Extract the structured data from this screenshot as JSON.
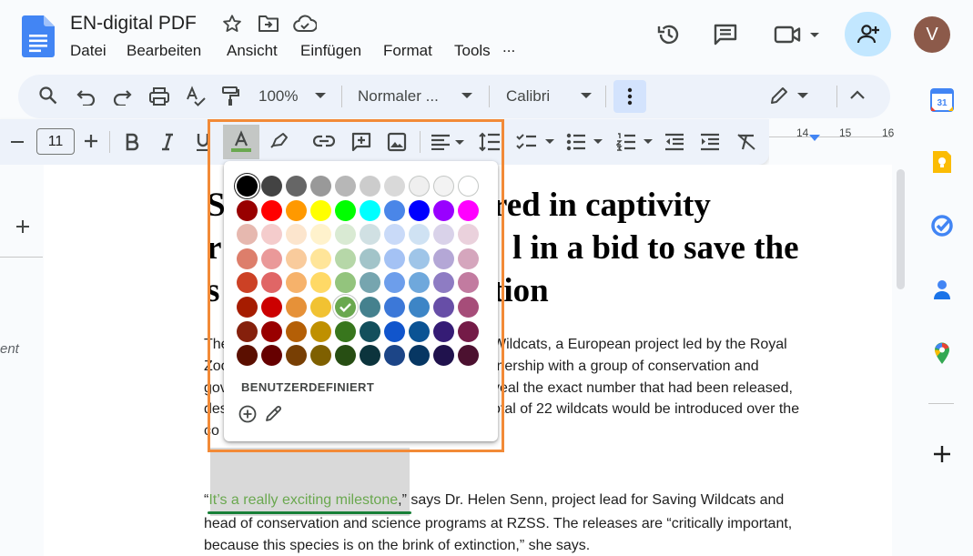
{
  "app": {
    "title": "EN-digital PDF",
    "menu": [
      "Datei",
      "Bearbeiten",
      "Ansicht",
      "Einfügen",
      "Format",
      "Tools",
      "..."
    ],
    "avatar_letter": "V"
  },
  "toolbar": {
    "zoom": "100%",
    "style": "Normaler ...",
    "font": "Calibri"
  },
  "format_bar": {
    "font_size": "11",
    "ruler_ticks": [
      "14",
      "15",
      "16"
    ]
  },
  "palette": {
    "custom_label": "BENUTZERDEFINIERT",
    "selected_color": "#6aa84f",
    "rows": [
      [
        "#000000",
        "#434343",
        "#666666",
        "#999999",
        "#b7b7b7",
        "#cccccc",
        "#d9d9d9",
        "#efefef",
        "#f3f3f3",
        "#ffffff"
      ],
      [
        "#980000",
        "#ff0000",
        "#ff9900",
        "#ffff00",
        "#00ff00",
        "#00ffff",
        "#4a86e8",
        "#0000ff",
        "#9900ff",
        "#ff00ff"
      ],
      [
        "#e6b8af",
        "#f4cccc",
        "#fce5cd",
        "#fff2cc",
        "#d9ead3",
        "#d0e0e3",
        "#c9daf8",
        "#cfe2f3",
        "#d9d2e9",
        "#ead1dc"
      ],
      [
        "#dd7e6b",
        "#ea9999",
        "#f9cb9c",
        "#ffe599",
        "#b6d7a8",
        "#a2c4c9",
        "#a4c2f4",
        "#9fc5e8",
        "#b4a7d6",
        "#d5a6bd"
      ],
      [
        "#cc4125",
        "#e06666",
        "#f6b26b",
        "#ffd966",
        "#93c47d",
        "#76a5af",
        "#6d9eeb",
        "#6fa8dc",
        "#8e7cc3",
        "#c27ba0"
      ],
      [
        "#a61c00",
        "#cc0000",
        "#e69138",
        "#f1c232",
        "#6aa84f",
        "#45818e",
        "#3c78d8",
        "#3d85c6",
        "#674ea7",
        "#a64d79"
      ],
      [
        "#85200c",
        "#990000",
        "#b45f06",
        "#bf9000",
        "#38761d",
        "#134f5c",
        "#1155cc",
        "#0b5394",
        "#351c75",
        "#741b47"
      ],
      [
        "#5b0f00",
        "#660000",
        "#783f04",
        "#7f6000",
        "#274e13",
        "#0c343d",
        "#1c4587",
        "#073763",
        "#20124d",
        "#4c1130"
      ]
    ]
  },
  "document": {
    "heading_lines": [
      {
        "left": "S",
        "right": "red in captivity"
      },
      {
        "left": "r",
        "right": "l in a bid to save the"
      },
      {
        "left": "s",
        "right": "tion"
      }
    ],
    "para1": [
      {
        "left": "The",
        "right": "Wildcats, a European project led by the Royal"
      },
      {
        "left": "Zoo",
        "right": "tnership with a group of conservation and"
      },
      {
        "left": "gov",
        "right": "veal the exact number that had been released,"
      },
      {
        "left": "des",
        "right": "otal of 22 wildcats would be introduced over the"
      },
      {
        "left": "co",
        "right": ""
      }
    ],
    "quote_open": "“",
    "quote_highlight": "It’s a really exciting milestone",
    "quote_rest": ",” says Dr. Helen Senn, project lead for Saving Wildcats and",
    "para2_line2": "head of conservation and science programs at RZSS. The releases are “critically important,",
    "para2_line3": "because this species is on the brink of extinction,” she says.",
    "margin_text": "ent"
  },
  "colors": {
    "highlight_green": "#6aa84f",
    "frame_orange": "#f28a37",
    "accent_blue": "#c2e7ff"
  }
}
